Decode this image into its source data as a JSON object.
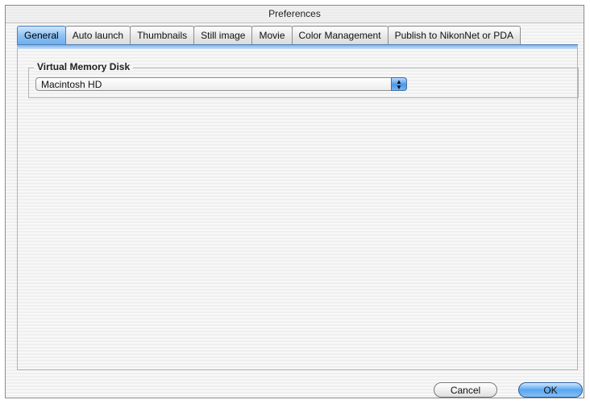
{
  "window": {
    "title": "Preferences"
  },
  "tabs": [
    {
      "label": "General",
      "active": true
    },
    {
      "label": "Auto launch",
      "active": false
    },
    {
      "label": "Thumbnails",
      "active": false
    },
    {
      "label": "Still image",
      "active": false
    },
    {
      "label": "Movie",
      "active": false
    },
    {
      "label": "Color Management",
      "active": false
    },
    {
      "label": "Publish to NikonNet or PDA",
      "active": false
    }
  ],
  "group": {
    "label": "Virtual Memory Disk",
    "popup_value": "Macintosh HD",
    "popup_icon": "up-down-arrows-icon"
  },
  "buttons": {
    "cancel": "Cancel",
    "ok": "OK"
  },
  "colors": {
    "accent": "#6fb0ef"
  }
}
